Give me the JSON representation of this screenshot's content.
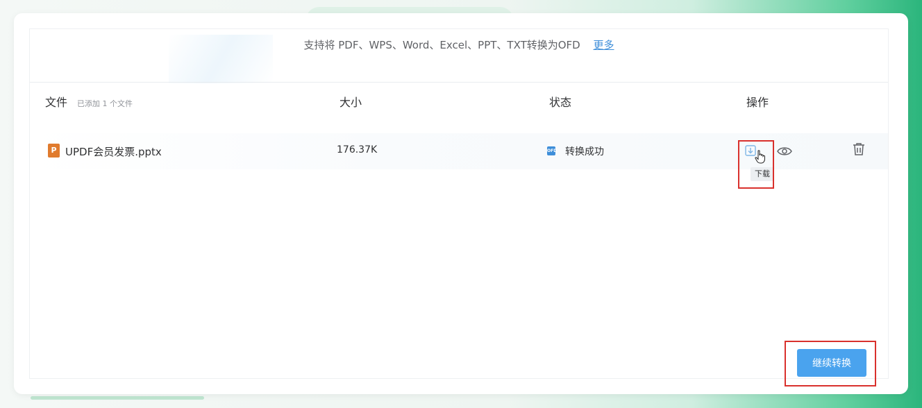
{
  "support": {
    "text": "支持将 PDF、WPS、Word、Excel、PPT、TXT转换为OFD",
    "more_link": "更多"
  },
  "table": {
    "columns": {
      "file": "文件",
      "file_count": "已添加 1 个文件",
      "size": "大小",
      "status": "状态",
      "actions": "操作"
    },
    "rows": [
      {
        "file_type_letter": "P",
        "file_name": "UPDF会员发票.pptx",
        "size": "176.37K",
        "status_icon_text": "OFD",
        "status": "转换成功"
      }
    ]
  },
  "tooltip": {
    "download": "下载"
  },
  "actions": {
    "continue_label": "继续转换"
  },
  "icons": {
    "file_type": "pptx-icon",
    "status": "ofd-file-icon",
    "download": "download-icon",
    "preview": "eye-icon",
    "delete": "trash-icon",
    "cursor": "hand-pointer-icon"
  },
  "colors": {
    "accent": "#4aa3ee",
    "link": "#3e8ed9",
    "pptx": "#e07b2e",
    "highlight": "#d9302c"
  }
}
